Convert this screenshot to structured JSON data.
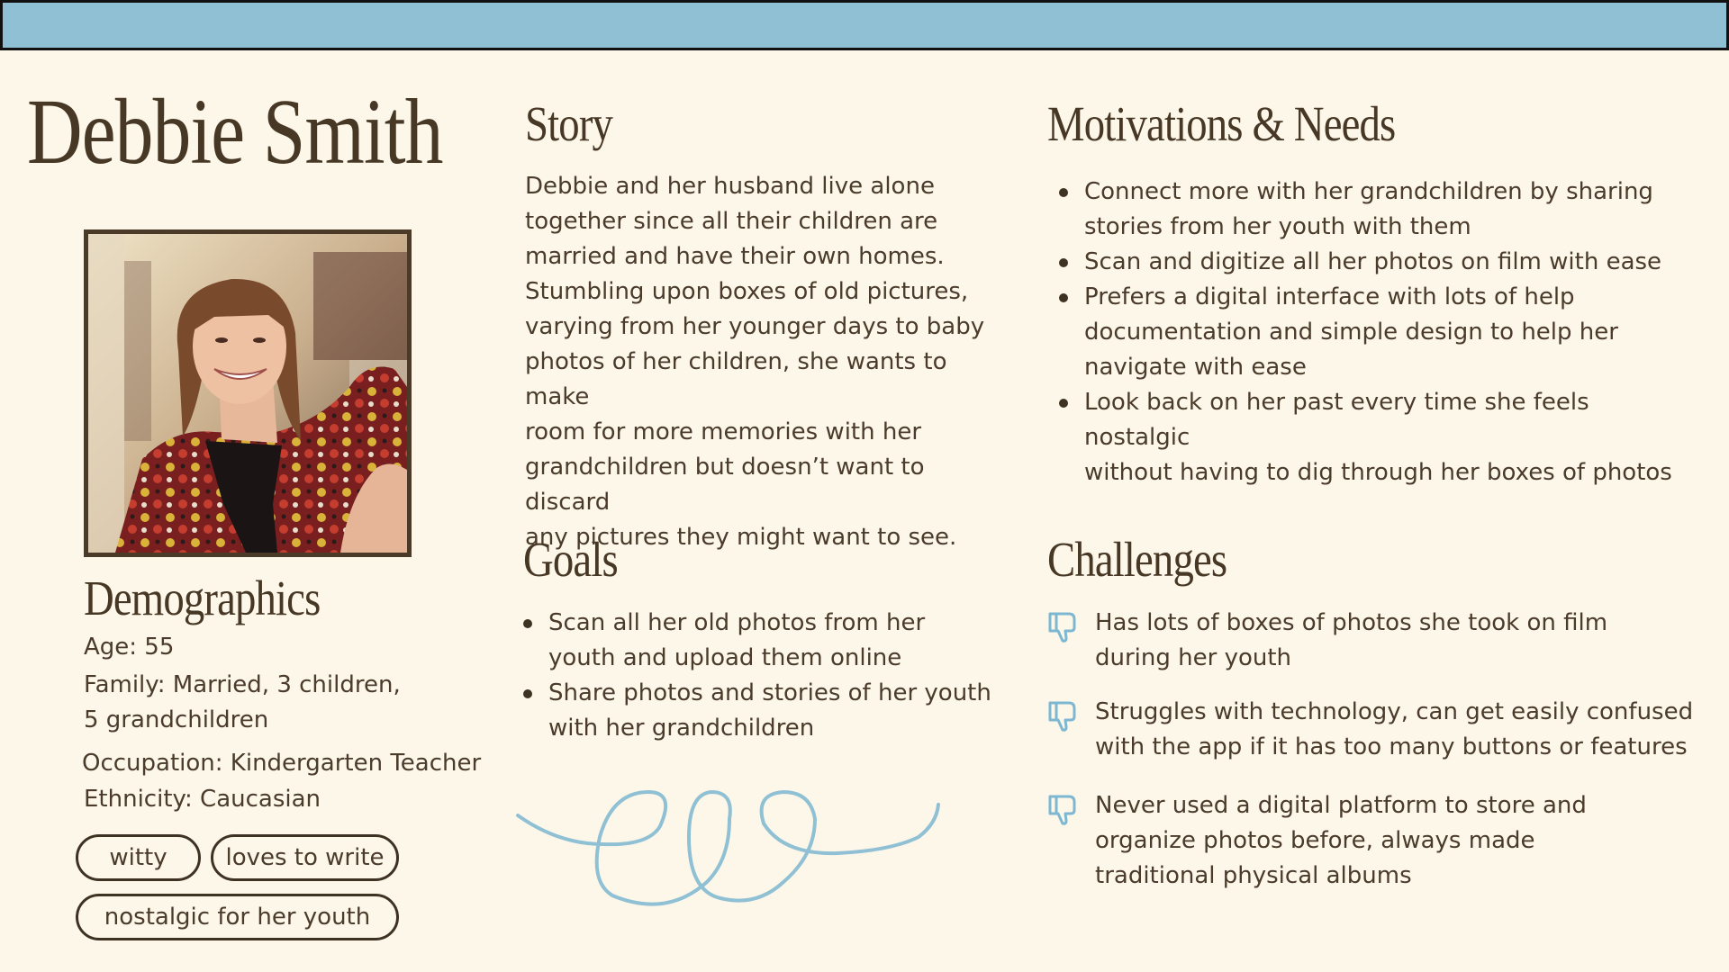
{
  "persona": {
    "name": "Debbie Smith"
  },
  "colors": {
    "background": "#fdf7ea",
    "top_bar": "#8fc0d4",
    "text": "#4a3b2b",
    "accent_blue": "#7db7d1",
    "border_dark": "#3e3223"
  },
  "photo": {
    "subject": "smiling woman with bangs wearing a floral jacket",
    "icon": "portrait-photo"
  },
  "demographics": {
    "title": "Demographics",
    "age": "Age: 55",
    "family_line1": "Family: Married, 3 children,",
    "family_line2": "5 grandchildren",
    "occupation": "Occupation: Kindergarten Teacher",
    "ethnicity": "Ethnicity: Caucasian"
  },
  "tags": [
    "witty",
    "loves to write",
    "nostalgic for her youth"
  ],
  "story": {
    "title": "Story",
    "lines": [
      "Debbie and her husband live alone",
      "together since all their children are",
      "married and have their own homes.",
      "Stumbling upon boxes of old pictures,",
      "varying from her younger days to baby",
      "photos of her children, she wants to make",
      "room for more memories with her",
      "grandchildren but doesn’t want to discard",
      "any pictures they might want to see."
    ]
  },
  "goals": {
    "title": "Goals",
    "items": [
      [
        "Scan all her old photos from her",
        "youth and upload them online"
      ],
      [
        "Share photos and stories of her youth",
        "with her grandchildren"
      ]
    ]
  },
  "motivations": {
    "title": "Motivations & Needs",
    "items": [
      [
        "Connect more with her grandchildren by sharing",
        "stories from her youth with them"
      ],
      [
        "Scan and digitize all her photos on film with ease"
      ],
      [
        "Prefers a digital interface with lots of help",
        "documentation and simple design to help her",
        "navigate with ease"
      ],
      [
        "Look back on her past every time she feels nostalgic",
        "without having to dig through her boxes of photos"
      ]
    ]
  },
  "challenges": {
    "title": "Challenges",
    "icon": "thumbs-down-icon",
    "items": [
      [
        "Has lots of boxes of photos she took on film",
        "during her youth"
      ],
      [
        "Struggles with technology, can get easily confused",
        "with the app if it has too many buttons or features"
      ],
      [
        "Never used a digital platform to store and",
        "organize photos before, always made",
        "traditional physical albums"
      ]
    ]
  }
}
